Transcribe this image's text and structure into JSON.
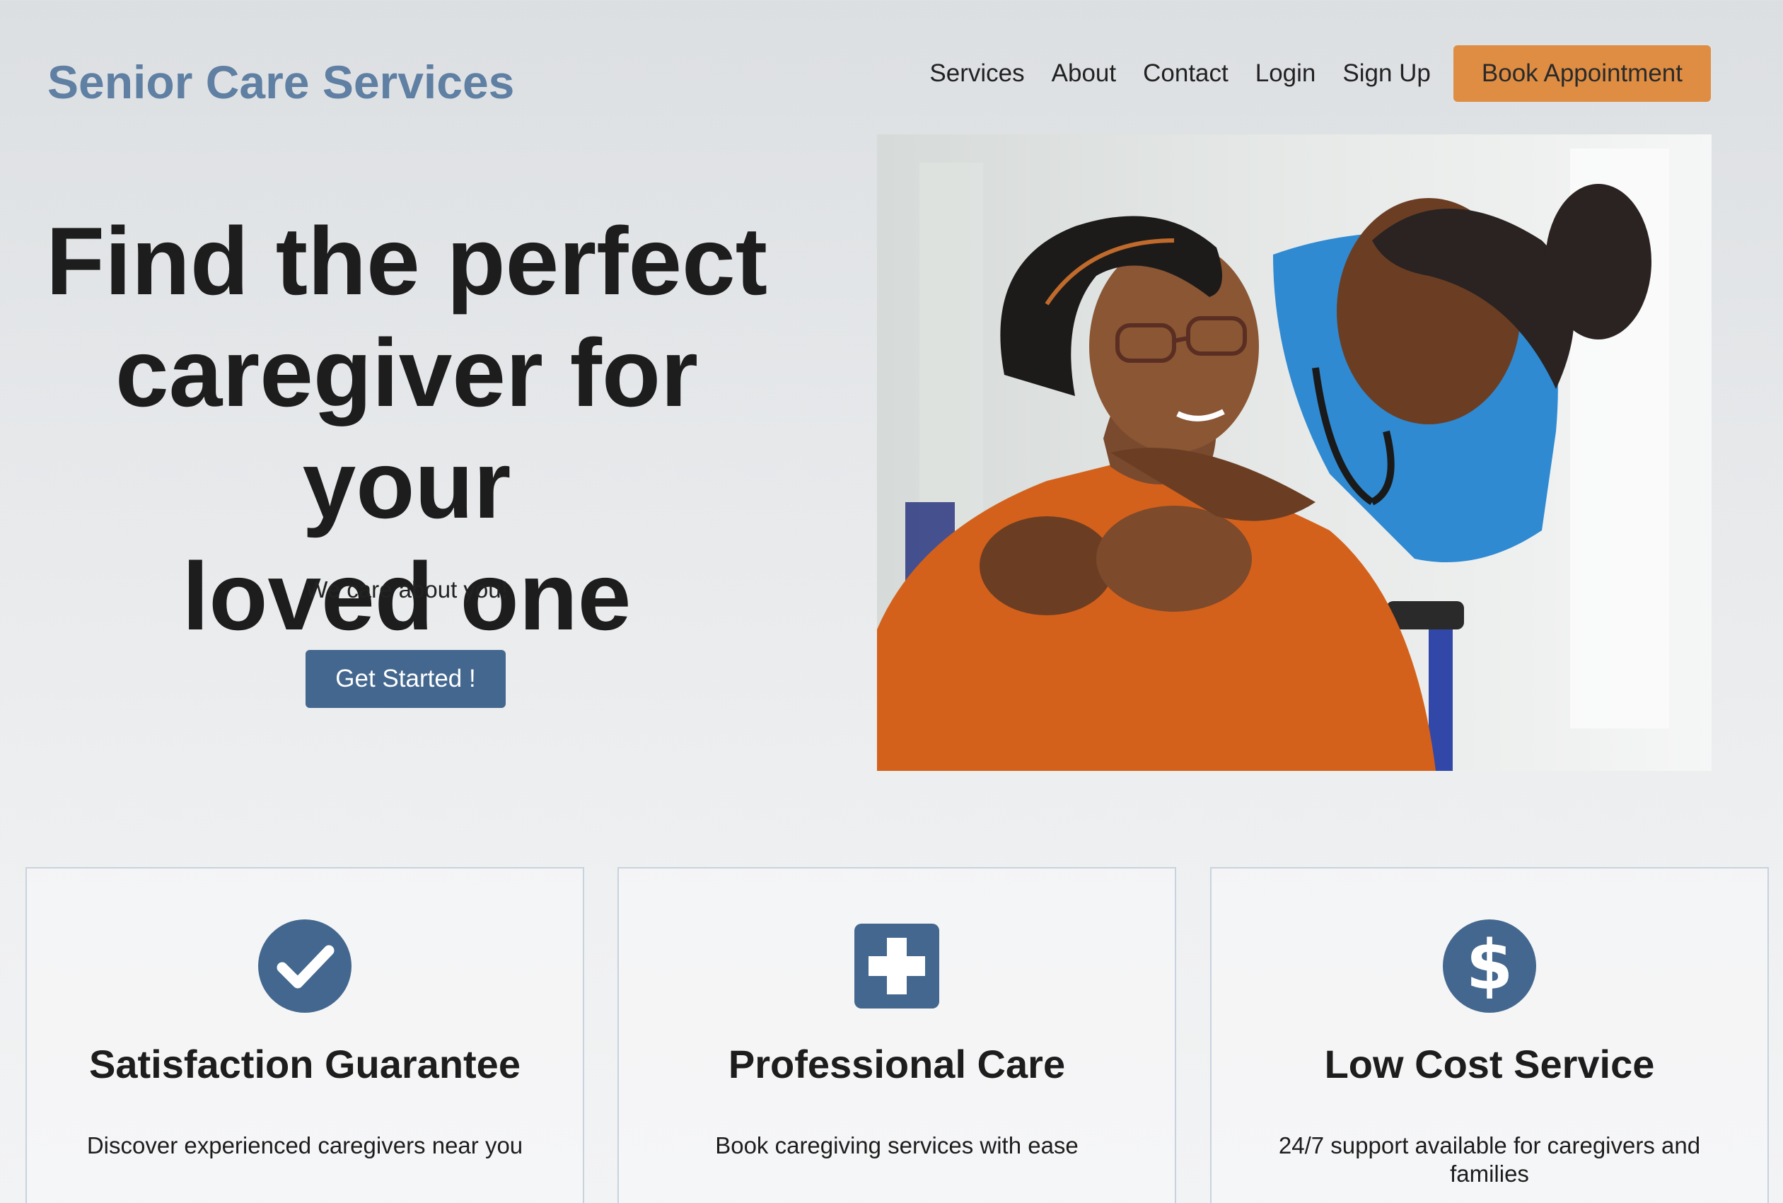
{
  "header": {
    "brand": "Senior Care Services",
    "nav": [
      {
        "label": "Services"
      },
      {
        "label": "About"
      },
      {
        "label": "Contact"
      },
      {
        "label": "Login"
      },
      {
        "label": "Sign Up"
      }
    ],
    "cta_label": "Book Appointment"
  },
  "hero": {
    "title_lines": [
      "Find the perfect",
      "caregiver for your",
      "loved one"
    ],
    "subtitle": "We care about you!",
    "button_label": "Get Started !",
    "image_icon": "photo-caregiver-with-senior"
  },
  "features": [
    {
      "icon": "check-circle-icon",
      "title": "Satisfaction Guarantee",
      "text": "Discover experienced caregivers near you"
    },
    {
      "icon": "medical-plus-icon",
      "title": "Professional Care",
      "text": "Book caregiving services with ease"
    },
    {
      "icon": "dollar-circle-icon",
      "title": "Low Cost Service",
      "text": "24/7 support available for caregivers and families"
    }
  ],
  "colors": {
    "brand": "#5f7fa3",
    "accent_orange": "#de8d43",
    "primary_blue": "#43678e",
    "icon_blue": "#43678e"
  }
}
